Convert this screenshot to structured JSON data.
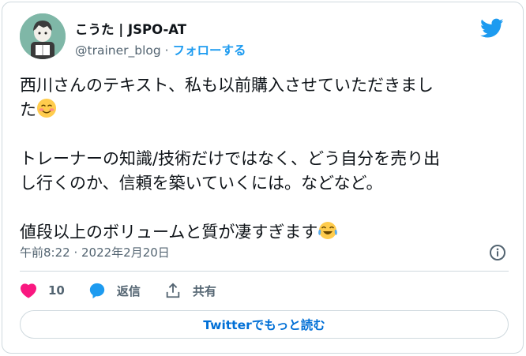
{
  "user": {
    "display_name": "こうた | JSPO-AT",
    "handle": "@trainer_blog",
    "separator": "·",
    "follow_label": "フォローする"
  },
  "tweet": {
    "line1": "西川さんのテキスト、私も以前購入させていただきまし",
    "line2_prefix": "た",
    "line3": "トレーナーの知識/技術だけではなく、どう自分を売り出",
    "line4": "し行くのか、信頼を築いていくには。などなど。",
    "line5_prefix": "値段以上のボリュームと質が凄すぎます"
  },
  "timestamp": "午前8:22 · 2022年2月20日",
  "actions": {
    "like_count": "10",
    "reply_label": "返信",
    "share_label": "共有"
  },
  "read_more_label": "Twitterでもっと読む",
  "colors": {
    "accent": "#1d9bf0",
    "like": "#f91880",
    "muted": "#536471",
    "border": "#cfd9de"
  },
  "icons": [
    "twitter-bird-icon",
    "info-icon",
    "heart-icon",
    "reply-bubble-icon",
    "share-icon",
    "blushing-smile-emoji",
    "tears-of-joy-emoji"
  ]
}
